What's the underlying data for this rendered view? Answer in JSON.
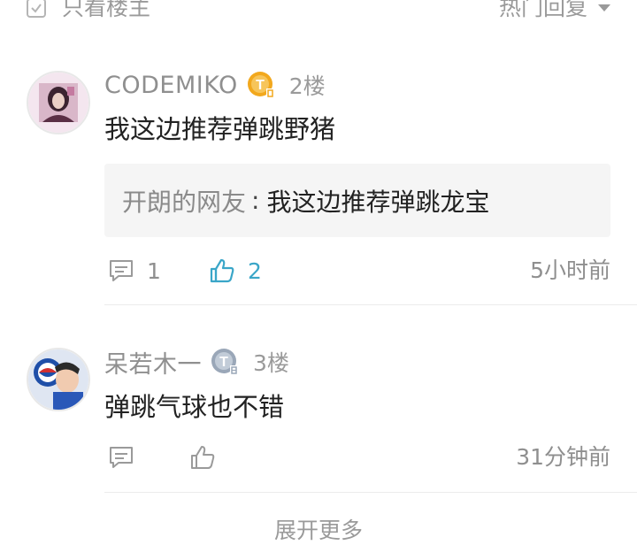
{
  "toolbar": {
    "only_op_label": "只看楼主",
    "sort_label": "热门回复"
  },
  "comments": [
    {
      "username": "CODEMIKO",
      "floor": "2楼",
      "content": "我这边推荐弹跳野猪",
      "reply": {
        "author": "开朗的网友",
        "separator": ":",
        "text": "我这边推荐弹跳龙宝"
      },
      "reply_count": "1",
      "like_count": "2",
      "time": "5小时前",
      "badge_color": "#f2a81d",
      "liked": true
    },
    {
      "username": "呆若木一",
      "floor": "3楼",
      "content": "弹跳气球也不错",
      "reply_count": "",
      "like_count": "",
      "time": "31分钟前",
      "badge_color": "#9aa7b8",
      "liked": false
    }
  ],
  "footer": {
    "more_label": "展开更多"
  },
  "colors": {
    "accent": "#3aa6c8",
    "muted": "#8f8f8f"
  }
}
